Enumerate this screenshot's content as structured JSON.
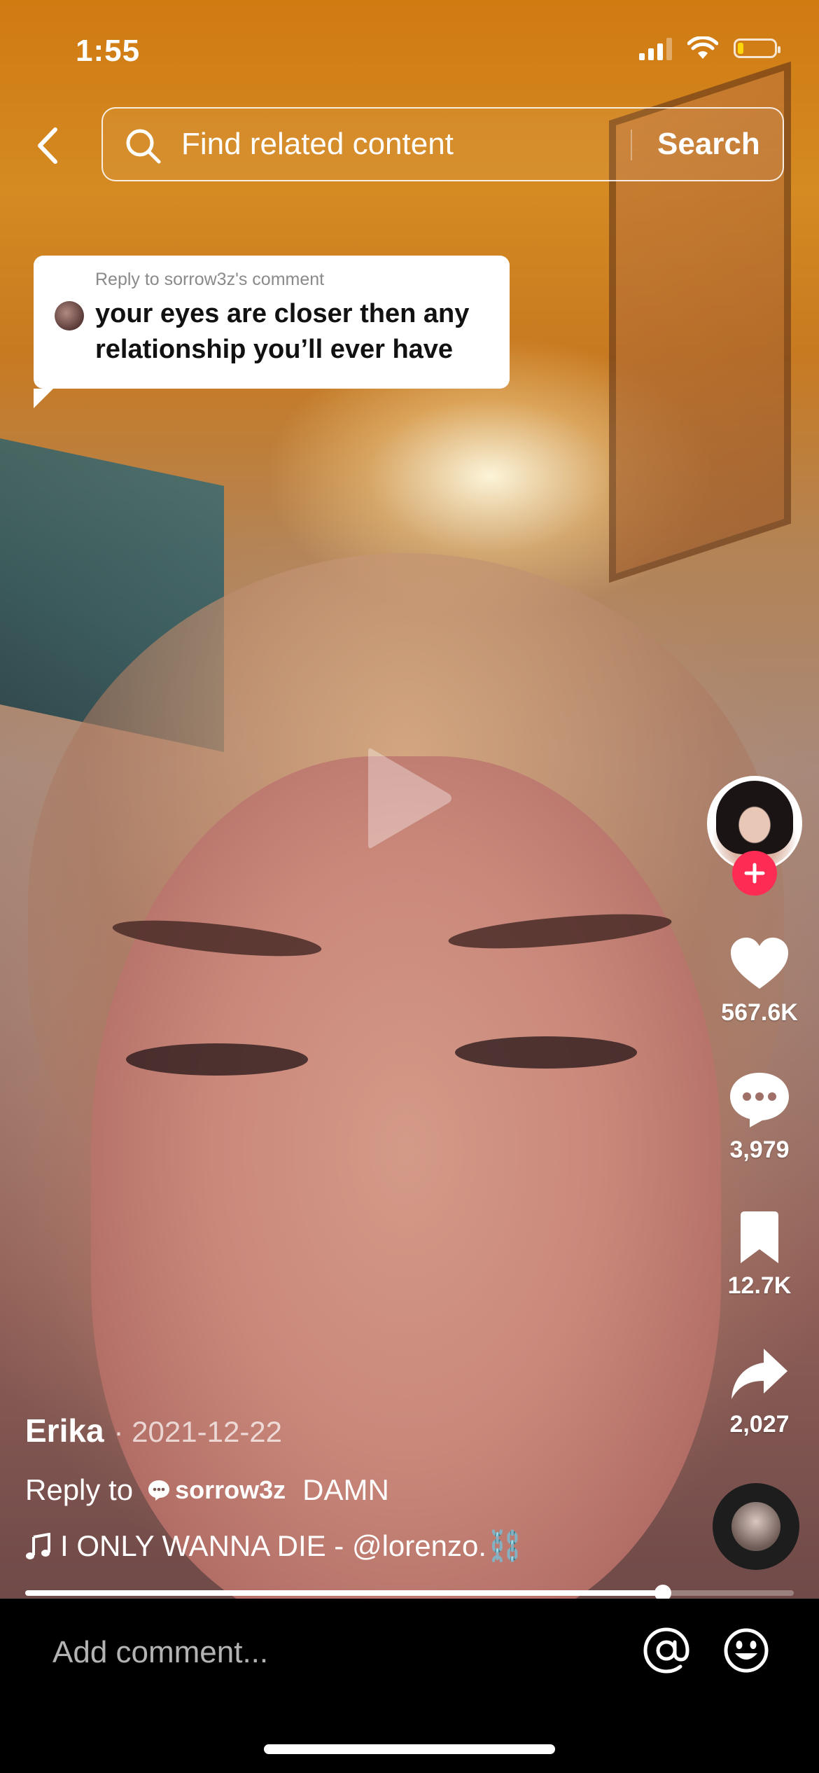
{
  "status_bar": {
    "time": "1:55"
  },
  "search": {
    "placeholder": "Find related content",
    "button_label": "Search"
  },
  "reply_card": {
    "header": "Reply to sorrow3z's comment",
    "comment": "your eyes are closer then any relationship you’ll ever have"
  },
  "actions": {
    "likes": "567.6K",
    "comments": "3,979",
    "saves": "12.7K",
    "shares": "2,027"
  },
  "post": {
    "author": "Erika",
    "date": "· 2021-12-22",
    "reply_prefix": "Reply to",
    "reply_user": "sorrow3z",
    "caption": "DAMN",
    "music": "I ONLY WANNA DIE - @lorenzo.⛓️"
  },
  "playback": {
    "progress_fraction": 0.83
  },
  "comment_bar": {
    "placeholder": "Add comment..."
  },
  "colors": {
    "follow_accent": "#fe2c55",
    "battery_low": "#ffd60a"
  },
  "icons": [
    "back-chevron-icon",
    "search-icon",
    "play-icon",
    "heart-icon",
    "comment-icon",
    "bookmark-icon",
    "share-icon",
    "music-note-icon",
    "at-icon",
    "emoji-icon",
    "plus-icon"
  ]
}
